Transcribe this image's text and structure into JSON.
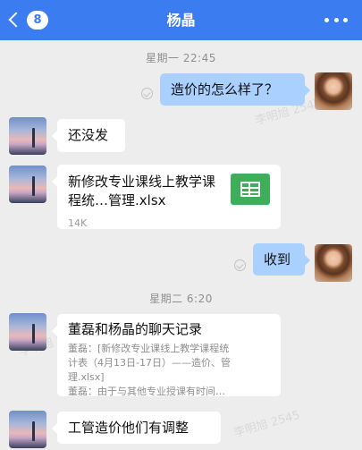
{
  "header": {
    "back_count": "8",
    "title": "杨晶"
  },
  "watermark": "李明旭 2545",
  "timestamps": [
    "星期一 22:45",
    "星期二 6:20"
  ],
  "messages": {
    "m1": {
      "text": "造价的怎么样了？"
    },
    "m2": {
      "text": "还没发"
    },
    "m3": {
      "file_name": "新修改专业课线上教学课程统…管理.xlsx",
      "file_size": "14K"
    },
    "m4": {
      "text": "收到"
    },
    "m5": {
      "title": "董磊和杨晶的聊天记录",
      "line1": "董磊：[新修改专业课线上教学课程统",
      "line2": "计表（4月13日-17日）——造价、管",
      "line3": "理.xlsx]",
      "line4": "董磊：由于与其他专业授课有时间…"
    },
    "m6": {
      "text": "工管造价他们有调整"
    }
  },
  "colors": {
    "header_bg": "#3b7cf0",
    "bubble_right": "#a9d0ff",
    "bubble_left": "#ffffff",
    "chat_bg": "#ededed",
    "xls_green": "#3fae5a"
  }
}
